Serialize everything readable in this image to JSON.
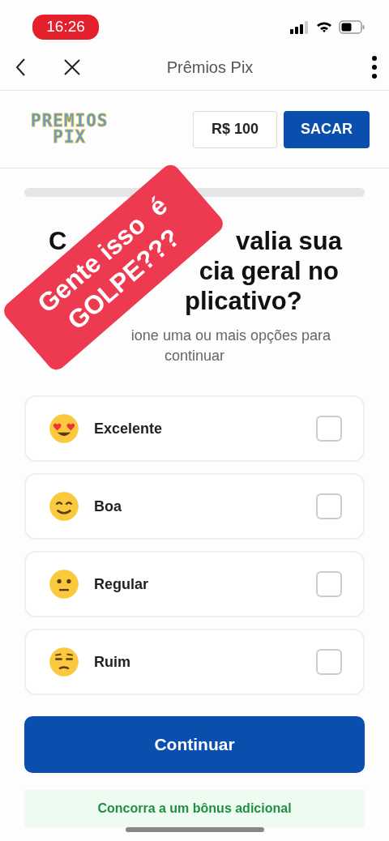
{
  "status_bar": {
    "time": "16:26"
  },
  "nav": {
    "title": "Prêmios Pix"
  },
  "header": {
    "logo_lines": [
      "PREMIOS",
      "PIX"
    ],
    "balance": "R$ 100",
    "withdraw": "SACAR"
  },
  "progress": {
    "level": 0
  },
  "question": {
    "title_fragments": [
      [
        "C",
        "valia sua"
      ],
      [
        "cia geral no"
      ],
      [
        "plicativo?"
      ]
    ],
    "subtitle_fragments": [
      "ione uma ou mais opções para",
      "continuar"
    ]
  },
  "options": [
    {
      "label": "Excelente",
      "kind": "love",
      "checked": false
    },
    {
      "label": "Boa",
      "kind": "smile",
      "checked": false
    },
    {
      "label": "Regular",
      "kind": "neutral",
      "checked": false
    },
    {
      "label": "Ruim",
      "kind": "unamused",
      "checked": false
    }
  ],
  "continue_button": "Continuar",
  "bonus": "Concorra a um bônus adicional",
  "sticker": {
    "lines": [
      "Gente isso  é",
      "GOLPE???"
    ]
  }
}
